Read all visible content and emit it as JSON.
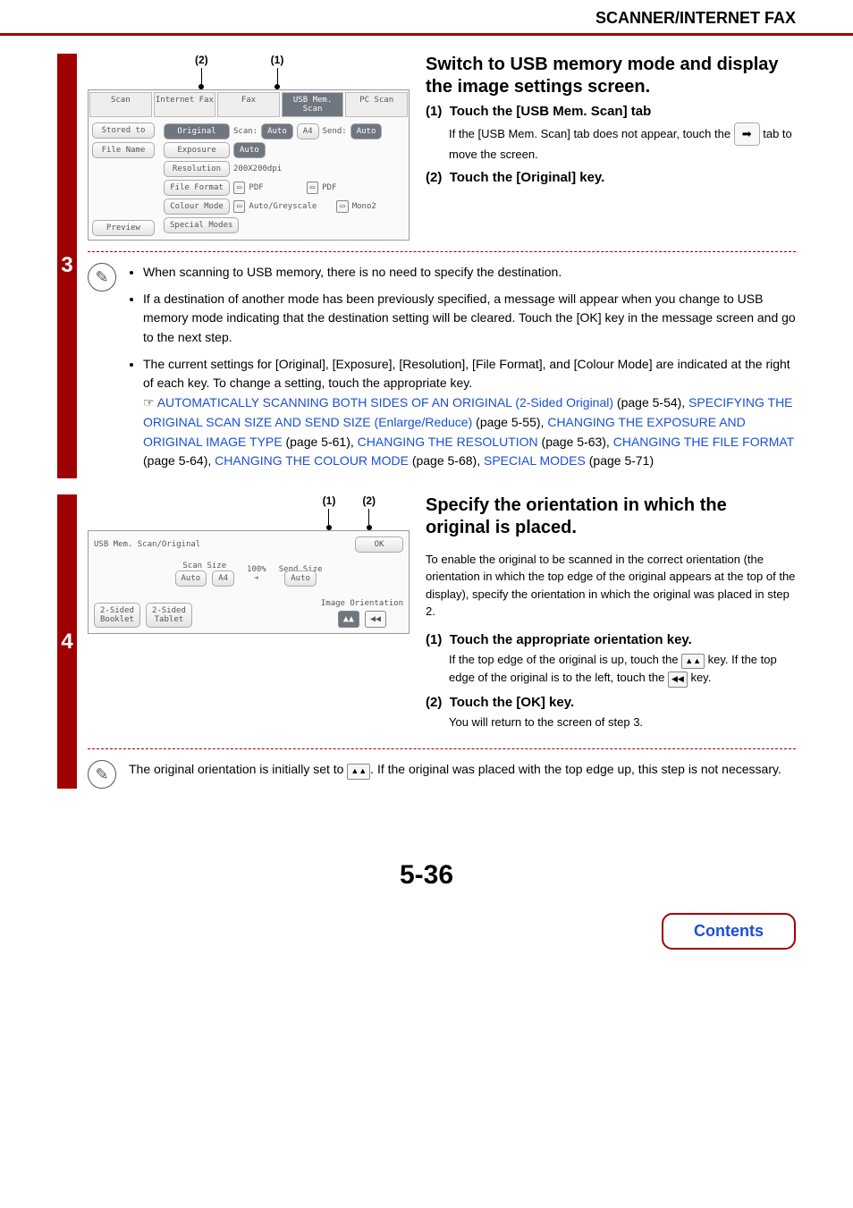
{
  "header": {
    "title": "SCANNER/INTERNET FAX"
  },
  "step3": {
    "number": "3",
    "callouts": {
      "c1": "(1)",
      "c2": "(2)"
    },
    "screen": {
      "tabs": [
        "Scan",
        "Internet Fax",
        "Fax",
        "USB Mem. Scan",
        "PC Scan"
      ],
      "side": {
        "stored": "Stored to",
        "filename": "File Name",
        "preview": "Preview"
      },
      "rows": {
        "original": "Original",
        "scan": "Scan:",
        "auto1": "Auto",
        "a4": "A4",
        "send": "Send:",
        "auto2": "Auto",
        "exposure": "Exposure",
        "autoexp": "Auto",
        "resolution": "Resolution",
        "resval": "200X200dpi",
        "fileformat": "File Format",
        "pdf1": "PDF",
        "pdf2": "PDF",
        "colour": "Colour Mode",
        "autogs": "Auto/Greyscale",
        "mono": "Mono2",
        "special": "Special Modes"
      }
    },
    "right": {
      "title": "Switch to USB memory mode and display the image settings screen.",
      "s1_label": "(1)",
      "s1": "Touch the [USB Mem. Scan] tab",
      "s1_body_a": "If the [USB Mem. Scan] tab does not appear, touch the",
      "s1_body_b": "tab to move the screen.",
      "s2_label": "(2)",
      "s2": "Touch the [Original] key."
    },
    "notes": {
      "b1": "When scanning to USB memory, there is no need to specify the destination.",
      "b2": "If a destination of another mode has been previously specified, a message will appear when you change to USB memory mode indicating that the destination setting will be cleared. Touch the [OK] key in the message screen and go to the next step.",
      "b3": "The current settings for [Original], [Exposure], [Resolution], [File Format], and [Colour Mode] are indicated at the right of each key. To change a setting, touch the appropriate key.",
      "hand": "☞",
      "l1": "AUTOMATICALLY SCANNING BOTH SIDES OF AN ORIGINAL (2-Sided Original)",
      "p1": " (page 5-54), ",
      "l2": "SPECIFYING THE ORIGINAL SCAN SIZE AND SEND SIZE (Enlarge/Reduce)",
      "p2": " (page 5-55), ",
      "l3": "CHANGING THE EXPOSURE AND ORIGINAL IMAGE TYPE",
      "p3": " (page 5-61), ",
      "l4": "CHANGING THE RESOLUTION",
      "p4": " (page 5-63), ",
      "l5": "CHANGING THE FILE FORMAT",
      "p5": " (page 5-64), ",
      "l6": "CHANGING THE COLOUR MODE",
      "p6": " (page 5-68), ",
      "l7": "SPECIAL MODES",
      "p7": " (page 5-71)"
    }
  },
  "step4": {
    "number": "4",
    "callouts": {
      "c1": "(1)",
      "c2": "(2)"
    },
    "screen": {
      "title": "USB Mem. Scan/Original",
      "ok": "OK",
      "scansize": "Scan Size",
      "pct": "100%",
      "sendsize": "Send Size",
      "auto": "Auto",
      "a4": "A4",
      "auto2": "Auto",
      "booklet": "2-Sided\nBooklet",
      "tablet": "2-Sided\nTablet",
      "imgorient": "Image Orientation"
    },
    "right": {
      "title": "Specify the orientation in which the original is placed.",
      "intro": "To enable the original to be scanned in the correct orientation (the orientation in which the top edge of the original appears at the top of the display), specify the orientation in which the original was placed in step 2.",
      "s1_label": "(1)",
      "s1": "Touch the appropriate orientation key.",
      "s1_body_a": "If the top edge of the original is up, touch the ",
      "s1_body_b": " key. If the top edge of the original is to the left, touch the ",
      "s1_body_c": " key.",
      "s2_label": "(2)",
      "s2": "Touch the [OK] key.",
      "s2_body": "You will return to the screen of step 3."
    },
    "note": {
      "a": "The original orientation is initially set to ",
      "b": ". If the original was placed with the top edge up, this step is not necessary."
    }
  },
  "footer": {
    "pagenum": "5-36",
    "contents": "Contents"
  }
}
